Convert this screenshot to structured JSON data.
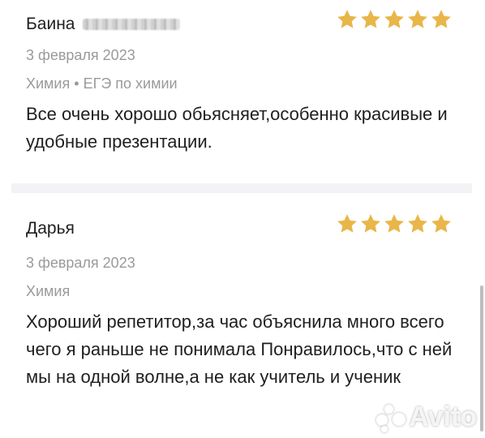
{
  "colors": {
    "star": "#e8b649",
    "muted": "#9a9a9a",
    "text": "#1f1f1f",
    "divider": "#f3f3f6"
  },
  "reviews": [
    {
      "author": "Баина",
      "rating": 5,
      "date": "3 февраля 2023",
      "subject": "Химия",
      "separator": "•",
      "course": "ЕГЭ по химии",
      "text": "Все очень хорошо обьясняет,особенно красивые и удобные презентации."
    },
    {
      "author": "Дарья",
      "rating": 5,
      "date": "3 февраля 2023",
      "subject": "Химия",
      "text": "Хороший репетитор,за час объяснила много всего чего я раньше не понимала Понравилось,что с ней мы на одной волне,а не как учитель и ученик"
    }
  ],
  "watermark": {
    "text": "Avito"
  }
}
